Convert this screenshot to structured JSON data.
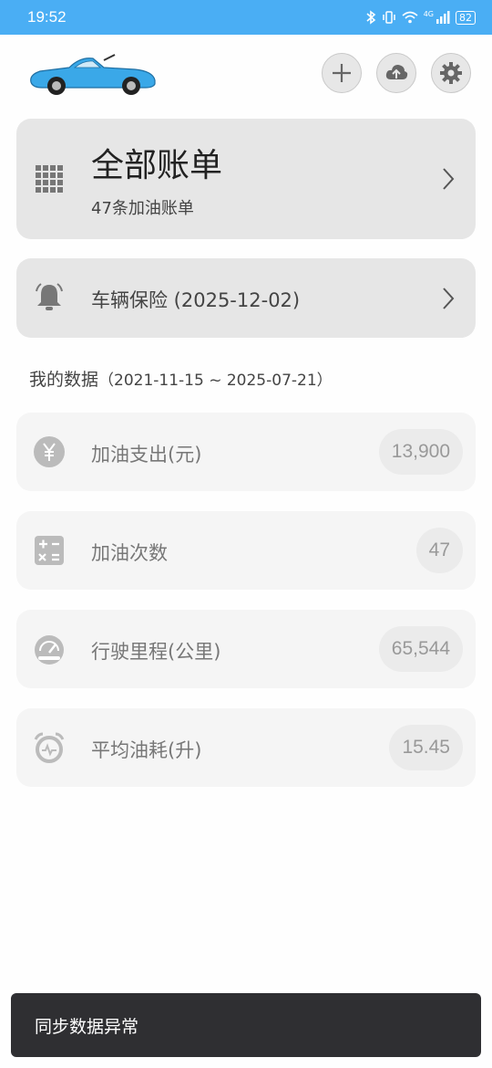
{
  "status_bar": {
    "time": "19:52",
    "network": "4G",
    "battery": "82"
  },
  "header": {
    "add_icon": "plus-icon",
    "sync_icon": "cloud-upload-icon",
    "settings_icon": "gear-icon"
  },
  "all_bills": {
    "title": "全部账单",
    "subtitle": "47条加油账单"
  },
  "insurance": {
    "label": "车辆保险 (2025-12-02)"
  },
  "my_data": {
    "title": "我的数据",
    "range": "（2021-11-15 ~ 2025-07-21）",
    "stats": [
      {
        "label": "加油支出(元)",
        "value": "13,900",
        "icon": "yen-icon"
      },
      {
        "label": "加油次数",
        "value": "47",
        "icon": "calculator-icon"
      },
      {
        "label": "行驶里程(公里)",
        "value": "65,544",
        "icon": "speedometer-icon"
      },
      {
        "label": "平均油耗(升)",
        "value": "15.45",
        "icon": "alarm-clock-icon"
      }
    ]
  },
  "toast": {
    "message": "同步数据异常"
  },
  "colors": {
    "status_bar": "#4aaef4",
    "car_body": "#3aa8e8",
    "card": "#e6e6e6",
    "stat_card": "#f5f5f5",
    "toast": "#2f2f32"
  }
}
